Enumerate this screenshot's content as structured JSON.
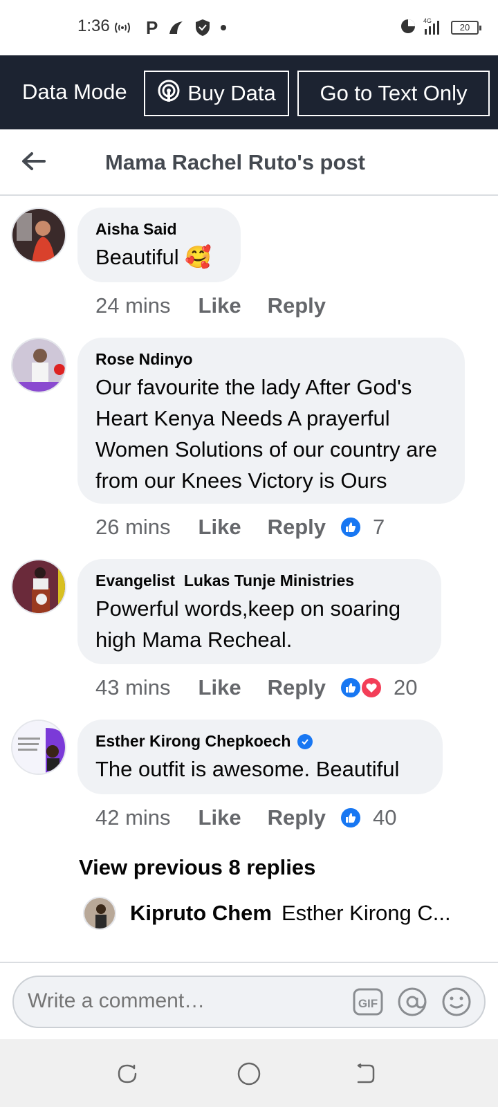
{
  "status": {
    "time": "1:36",
    "battery": "20",
    "network": "4G"
  },
  "data_bar": {
    "mode_label": "Data Mode",
    "buy_label": "Buy Data",
    "text_only_label": "Go to Text Only"
  },
  "header": {
    "title": "Mama Rachel Ruto's post"
  },
  "comments": [
    {
      "author": "Aisha Said",
      "text": "Beautiful 🥰",
      "time": "24 mins",
      "like": "Like",
      "reply": "Reply",
      "reactions": ""
    },
    {
      "author": "Rose Ndinyo",
      "text": "Our favourite the lady After God's Heart Kenya Needs A prayerful Women Solutions of our country are from our Knees Victory is Ours",
      "time": "26 mins",
      "like": "Like",
      "reply": "Reply",
      "reactions": "7"
    },
    {
      "author": "Evangelist  Lukas Tunje Ministries",
      "text": "Powerful words,keep on soaring high Mama Recheal.",
      "time": "43 mins",
      "like": "Like",
      "reply": "Reply",
      "reactions": "20"
    },
    {
      "author": "Esther Kirong Chepkoech",
      "text": "The outfit is awesome. Beautiful",
      "time": "42 mins",
      "like": "Like",
      "reply": "Reply",
      "reactions": "40"
    }
  ],
  "replies": {
    "view_previous": "View previous 8 replies",
    "preview_name": "Kipruto Chem",
    "preview_text": "Esther Kirong C..."
  },
  "composer": {
    "placeholder": "Write a comment…",
    "gif_label": "GIF"
  },
  "colors": {
    "data_bar": "#1c2331",
    "bubble": "#f0f2f5",
    "accent": "#1877f2",
    "love": "#f33e58"
  }
}
